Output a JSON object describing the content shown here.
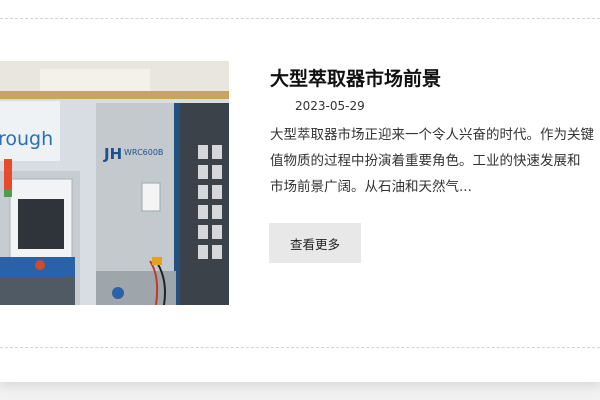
{
  "article": {
    "title": "大型萃取器市场前景",
    "date": "2023-05-29",
    "excerpt_lines": [
      "大型萃取器市场正迎来一个令人兴奋的时代。作为关键",
      "值物质的过程中扮演着重要角色。工业的快速发展和",
      "市场前景广阔。从石油和天然气..."
    ],
    "more_label": "查看更多"
  },
  "thumbnail": {
    "sign_text": "rough",
    "machine_brand": "JH",
    "machine_model": "WRC600B"
  },
  "colors": {
    "button_bg": "#e8e8e8",
    "title": "#111111",
    "machine_blue": "#1f5fa8"
  }
}
